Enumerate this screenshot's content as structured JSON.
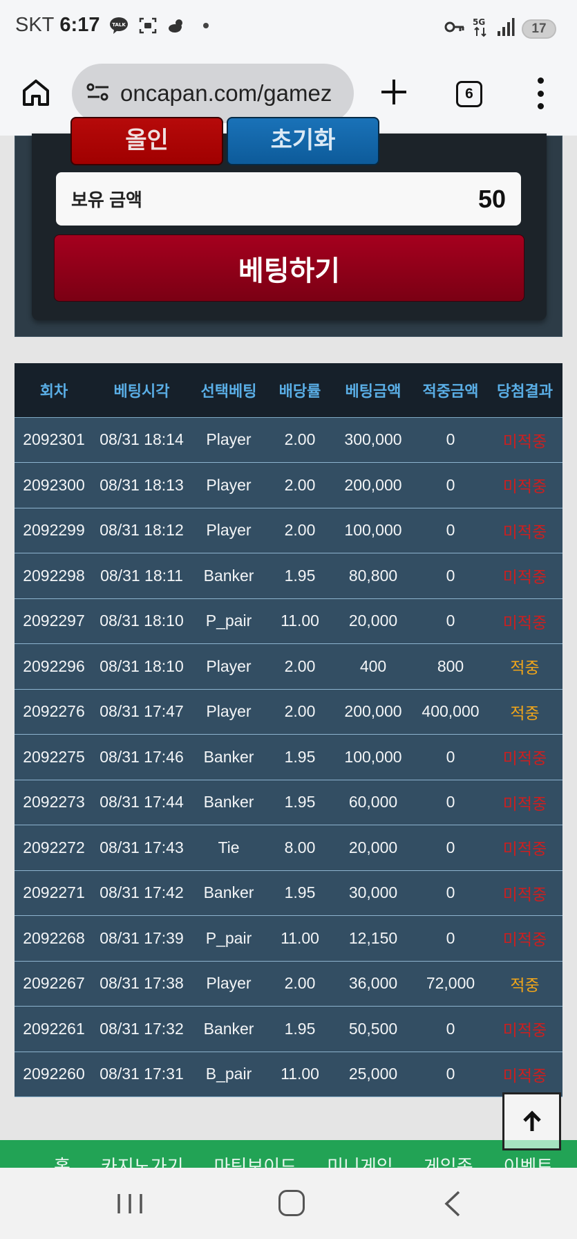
{
  "status_bar": {
    "carrier": "SKT",
    "time": "6:17",
    "notification_icons": [
      "talk-icon",
      "screenshot-icon",
      "weather-icon",
      "dot-icon"
    ],
    "right_icons": [
      "key-icon",
      "5g-icon",
      "signal-icon"
    ],
    "battery": "17"
  },
  "browser": {
    "url": "oncapan.com/gamez",
    "tab_count": "6"
  },
  "panel": {
    "allin_label": "올인",
    "reset_label": "초기화",
    "balance_label": "보유 금액",
    "balance_value": "50",
    "bet_button_label": "베팅하기"
  },
  "table": {
    "headers": [
      "회차",
      "베팅시각",
      "선택베팅",
      "배당률",
      "베팅금액",
      "적중금액",
      "당첨결과"
    ],
    "rows": [
      [
        "2092301",
        "08/31 18:14",
        "Player",
        "2.00",
        "300,000",
        "0",
        "미적중"
      ],
      [
        "2092300",
        "08/31 18:13",
        "Player",
        "2.00",
        "200,000",
        "0",
        "미적중"
      ],
      [
        "2092299",
        "08/31 18:12",
        "Player",
        "2.00",
        "100,000",
        "0",
        "미적중"
      ],
      [
        "2092298",
        "08/31 18:11",
        "Banker",
        "1.95",
        "80,800",
        "0",
        "미적중"
      ],
      [
        "2092297",
        "08/31 18:10",
        "P_pair",
        "11.00",
        "20,000",
        "0",
        "미적중"
      ],
      [
        "2092296",
        "08/31 18:10",
        "Player",
        "2.00",
        "400",
        "800",
        "적중"
      ],
      [
        "2092276",
        "08/31 17:47",
        "Player",
        "2.00",
        "200,000",
        "400,000",
        "적중"
      ],
      [
        "2092275",
        "08/31 17:46",
        "Banker",
        "1.95",
        "100,000",
        "0",
        "미적중"
      ],
      [
        "2092273",
        "08/31 17:44",
        "Banker",
        "1.95",
        "60,000",
        "0",
        "미적중"
      ],
      [
        "2092272",
        "08/31 17:43",
        "Tie",
        "8.00",
        "20,000",
        "0",
        "미적중"
      ],
      [
        "2092271",
        "08/31 17:42",
        "Banker",
        "1.95",
        "30,000",
        "0",
        "미적중"
      ],
      [
        "2092268",
        "08/31 17:39",
        "P_pair",
        "11.00",
        "12,150",
        "0",
        "미적중"
      ],
      [
        "2092267",
        "08/31 17:38",
        "Player",
        "2.00",
        "36,000",
        "72,000",
        "적중"
      ],
      [
        "2092261",
        "08/31 17:32",
        "Banker",
        "1.95",
        "50,500",
        "0",
        "미적중"
      ],
      [
        "2092260",
        "08/31 17:31",
        "B_pair",
        "11.00",
        "25,000",
        "0",
        "미적중"
      ]
    ]
  },
  "footer_menu": [
    "홈",
    "카지노가기",
    "마틴보이드",
    "미니게임",
    "게임존",
    "이벤트"
  ],
  "colors": {
    "win": "#f0a51a",
    "lose": "#cc1f1f",
    "header_text": "#5aaee6",
    "footer_green": "#22a355"
  }
}
